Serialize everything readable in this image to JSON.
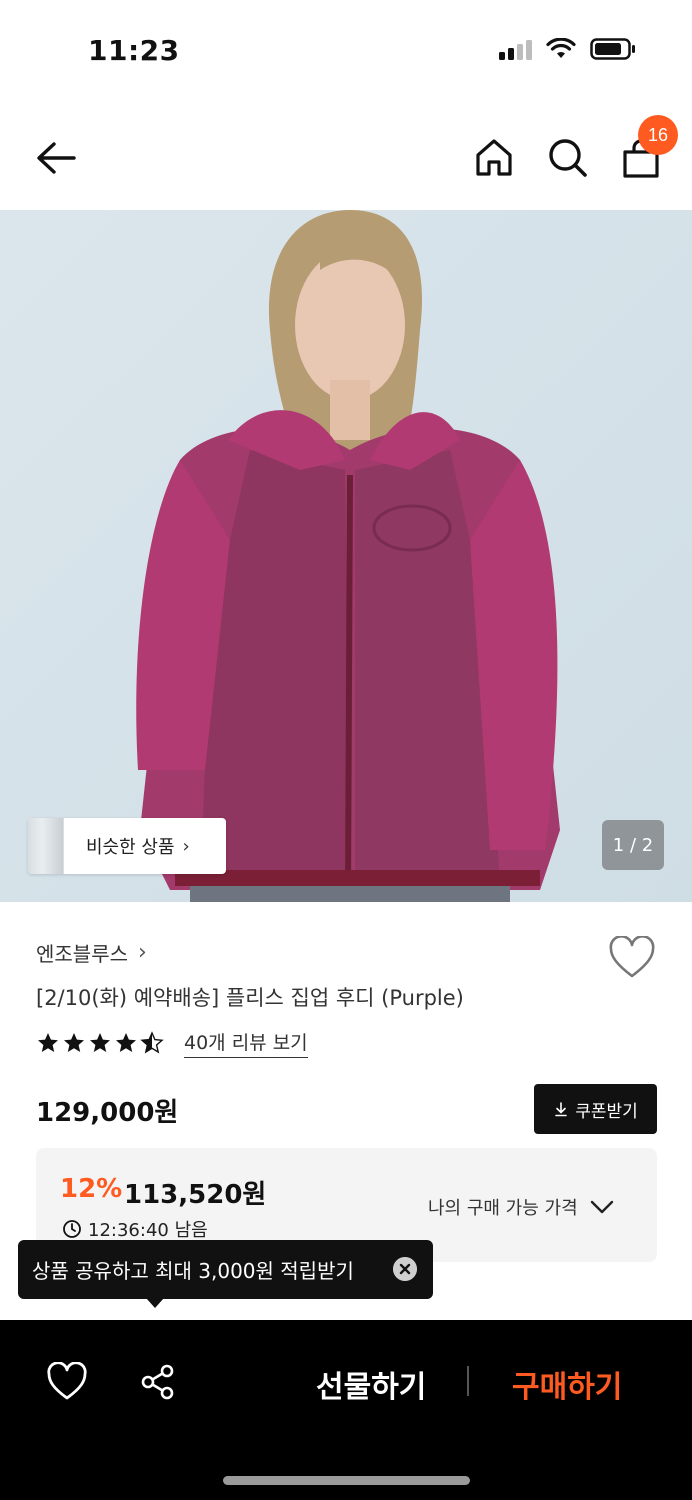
{
  "status": {
    "time": "11:23"
  },
  "nav": {
    "cart_count": "16"
  },
  "hero": {
    "similar_label": "비슷한 상품",
    "pager": "1 / 2"
  },
  "product": {
    "brand": "엔조블루스",
    "title": "[2/10(화) 예약배송] 플리스 집업 후디 (Purple)",
    "rating": 4.5,
    "review_link": "40개 리뷰 보기",
    "price": "129,000원",
    "coupon_label": "쿠폰받기",
    "sale_percent": "12%",
    "sale_price": "113,520원",
    "timer": "12:36:40 남음",
    "my_price_label": "나의 구매 가능 가격"
  },
  "tooltip": {
    "text": "상품 공유하고 최대 3,000원 적립받기"
  },
  "bottom": {
    "gift_label": "선물하기",
    "buy_label": "구매하기"
  },
  "colors": {
    "accent": "#ff5a1f",
    "dark": "#111111",
    "panel": "#f4f4f4"
  }
}
